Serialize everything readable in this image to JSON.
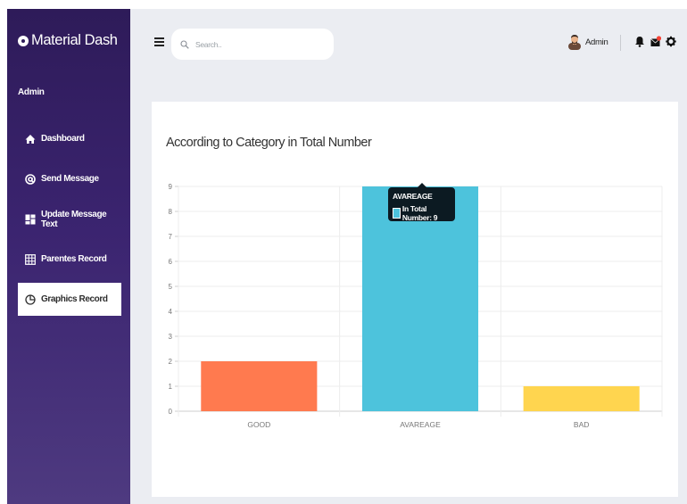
{
  "sidebar": {
    "brand": "Material Dash",
    "user": "Admin",
    "items": [
      {
        "label": "Dashboard",
        "icon": "home-icon",
        "active": false
      },
      {
        "label": "Send Message",
        "icon": "at-icon",
        "active": false
      },
      {
        "label": "Update Message Text",
        "icon": "dashboard-icon",
        "active": false
      },
      {
        "label": "Parentes Record",
        "icon": "grid-icon",
        "active": false
      },
      {
        "label": "Graphics Record",
        "icon": "pie-chart-icon",
        "active": true
      }
    ]
  },
  "topbar": {
    "search_placeholder": "Search..",
    "profile_name": "Admin",
    "icons": [
      "bell-icon",
      "mail-icon",
      "gear-icon"
    ]
  },
  "card": {
    "title": "According to Category in Total Number"
  },
  "tooltip": {
    "title": "AVAREAGE",
    "label": "In Total Number: 9"
  },
  "chart_data": {
    "type": "bar",
    "categories": [
      "GOOD",
      "AVAREAGE",
      "BAD"
    ],
    "values": [
      2,
      9,
      1
    ],
    "colors": [
      "#ff7a4f",
      "#4dc3dc",
      "#ffd54f"
    ],
    "series": [
      {
        "name": "In Total Number",
        "values": [
          2,
          9,
          1
        ]
      }
    ],
    "ylim": [
      0,
      9
    ],
    "yticks": [
      0,
      1,
      2,
      3,
      4,
      5,
      6,
      7,
      8,
      9
    ],
    "grid": true,
    "title": "According to Category in Total Number"
  }
}
